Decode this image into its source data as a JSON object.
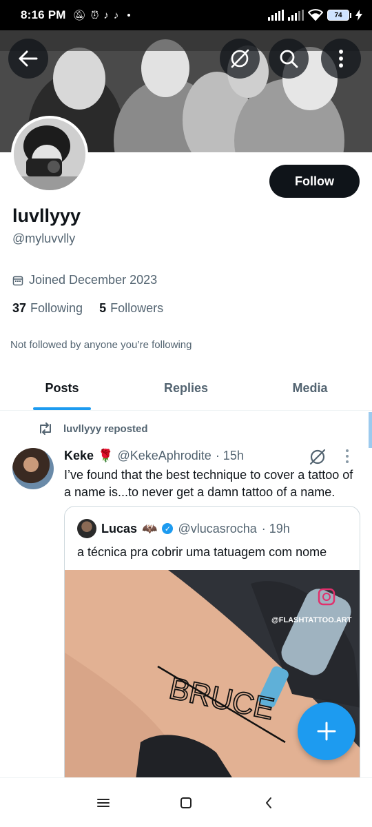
{
  "status_bar": {
    "time": "8:16 PM",
    "battery": "74",
    "icons": [
      "mute-icon",
      "alarm-icon",
      "tiktok-icon",
      "tiktok-icon",
      "signal-icon",
      "signal-icon",
      "wifi-icon",
      "charging-icon"
    ]
  },
  "header": {
    "back_icon": "arrow-left-icon",
    "grok_icon": "grok-icon",
    "search_icon": "search-icon",
    "more_icon": "more-vertical-icon"
  },
  "profile": {
    "display_name": "luvllyyy",
    "handle": "@myluvvlly",
    "joined": "Joined December 2023",
    "following_count": "37",
    "following_label": "Following",
    "followers_count": "5",
    "followers_label": "Followers",
    "not_followed_text": "Not followed by anyone you’re following",
    "follow_button": "Follow"
  },
  "tabs": [
    {
      "label": "Posts",
      "active": true
    },
    {
      "label": "Replies",
      "active": false
    },
    {
      "label": "Media",
      "active": false
    }
  ],
  "post": {
    "repost_label": "luvllyyy reposted",
    "author_name": "Keke",
    "author_emoji": "🌹",
    "author_handle": "@KekeAphrodite",
    "time": "· 15h",
    "text": "I’ve found that the best technique to cover a tattoo of a name is...to never get a damn tattoo of a name.",
    "quote": {
      "author_name": "Lucas",
      "author_emoji": "🦇",
      "author_handle": "@vlucasrocha",
      "time": "· 19h",
      "text": "a técnica pra cobrir uma tatuagem com nome",
      "media_watermark": "@FLASHTATTOO.ART",
      "media_tattoo_text": "BRUCE"
    }
  },
  "colors": {
    "accent": "#1d9bf0",
    "text_primary": "#0f1419",
    "text_secondary": "#536471",
    "button_dark": "#0f1419"
  }
}
